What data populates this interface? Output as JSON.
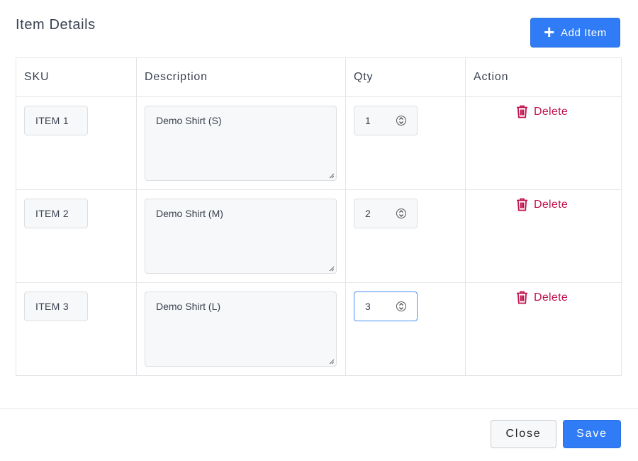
{
  "header": {
    "title": "Item Details",
    "add_button_label": "Add Item",
    "add_icon": "plus-icon"
  },
  "table": {
    "columns": [
      "SKU",
      "Description",
      "Qty",
      "Action"
    ],
    "rows": [
      {
        "sku": "ITEM 1",
        "description": "Demo Shirt (S)",
        "qty": "1",
        "action": "Delete"
      },
      {
        "sku": "ITEM 2",
        "description": "Demo Shirt (M)",
        "qty": "2",
        "action": "Delete"
      },
      {
        "sku": "ITEM 3",
        "description": "Demo Shirt (L)",
        "qty": "3",
        "action": "Delete"
      }
    ],
    "delete_icon": "trash-icon"
  },
  "footer": {
    "close_label": "Close",
    "save_label": "Save"
  },
  "colors": {
    "primary": "#2f7cf6",
    "danger": "#c0134f",
    "border": "#e3e5e8",
    "focus": "#4a8ef5"
  }
}
